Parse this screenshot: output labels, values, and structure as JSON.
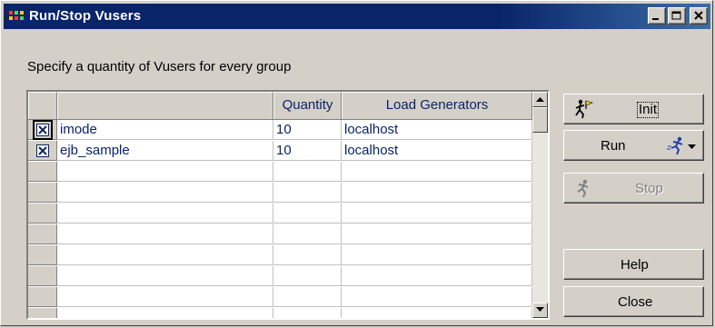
{
  "window": {
    "title": "Run/Stop Vusers",
    "controls": [
      "minimize-icon",
      "maximize-icon",
      "close-icon"
    ]
  },
  "instruction": "Specify a quantity of Vusers for every group",
  "grid": {
    "columns": [
      "",
      "",
      "Quantity",
      "Load Generators"
    ],
    "rows": [
      {
        "checked": true,
        "group": "imode",
        "quantity": "10",
        "load_generators": "localhost"
      },
      {
        "checked": true,
        "group": "ejb_sample",
        "quantity": "10",
        "load_generators": "localhost"
      }
    ],
    "empty_rows": 8
  },
  "buttons": {
    "init": "Init",
    "run": "Run",
    "stop": "Stop",
    "help": "Help",
    "close": "Close"
  },
  "colors": {
    "title_bar": "#0a246a",
    "face": "#d4d0c8",
    "grid_text": "#0a246a"
  }
}
